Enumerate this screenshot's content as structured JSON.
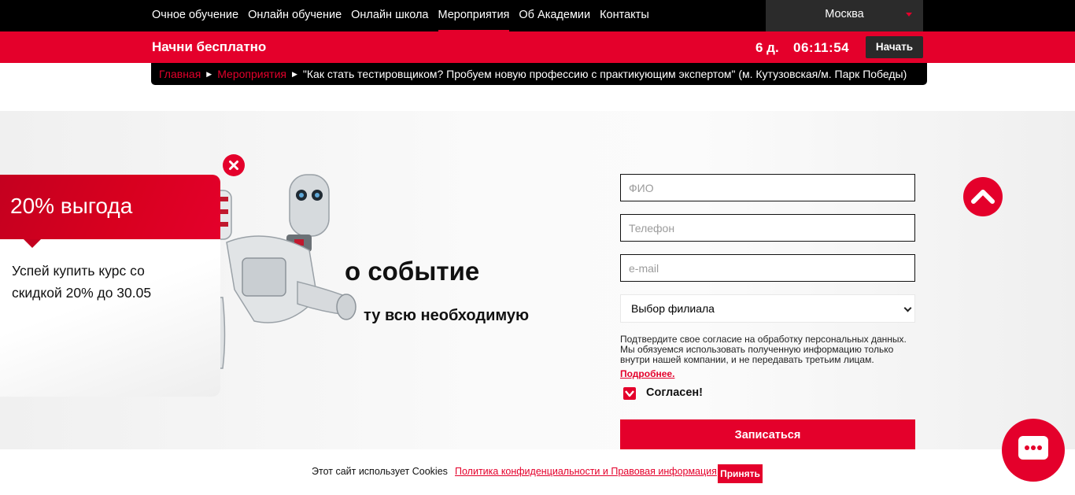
{
  "nav": {
    "items": [
      {
        "label": "Очное обучение"
      },
      {
        "label": "Онлайн обучение"
      },
      {
        "label": "Онлайн школа"
      },
      {
        "label": "Мероприятия",
        "active": true
      },
      {
        "label": "Об Академии"
      },
      {
        "label": "Контакты"
      }
    ],
    "city": "Москва"
  },
  "promo_bar": {
    "title": "Начни бесплатно",
    "days": "6 д.",
    "time": "06:11:54",
    "start_label": "Начать"
  },
  "breadcrumb": {
    "home": "Главная",
    "events": "Мероприятия",
    "current": "\"Как стать тестировщиком? Пробуем новую профессию с практикующим экспертом\" (м. Кутузовская/м. Парк Победы)"
  },
  "hero": {
    "title_visible": "о событие",
    "subtitle_visible": "ту всю необходимую"
  },
  "form": {
    "name_placeholder": "ФИО",
    "phone_placeholder": "Телефон",
    "email_placeholder": "e-mail",
    "branch_select": "Выбор филиала",
    "consent_text": "Подтвердите свое согласие на обработку персональных данных. Мы обязуемся использовать полученную информацию только внутри нашей компании, и не передавать третьим лицам.",
    "more_link": "Подробнее.",
    "agree_label": "Согласен!",
    "agree_checked": true,
    "submit_label": "Записаться"
  },
  "popup": {
    "title": "20% выгода",
    "text": "Успей купить курс со скидкой 20% до 30.05"
  },
  "cookie": {
    "text": "Этот сайт использует Cookies",
    "link": "Политика конфиденциальности и Правовая информация",
    "accept_label": "Принять"
  },
  "colors": {
    "brand_red": "#e4002b",
    "nav_bg": "#000000",
    "city_bg": "#2b2b2b"
  },
  "icons": [
    "chevron-down-icon",
    "breadcrumb-arrow-icon",
    "checkbox-check-icon",
    "chevron-up-icon",
    "chat-icon",
    "close-icon"
  ]
}
